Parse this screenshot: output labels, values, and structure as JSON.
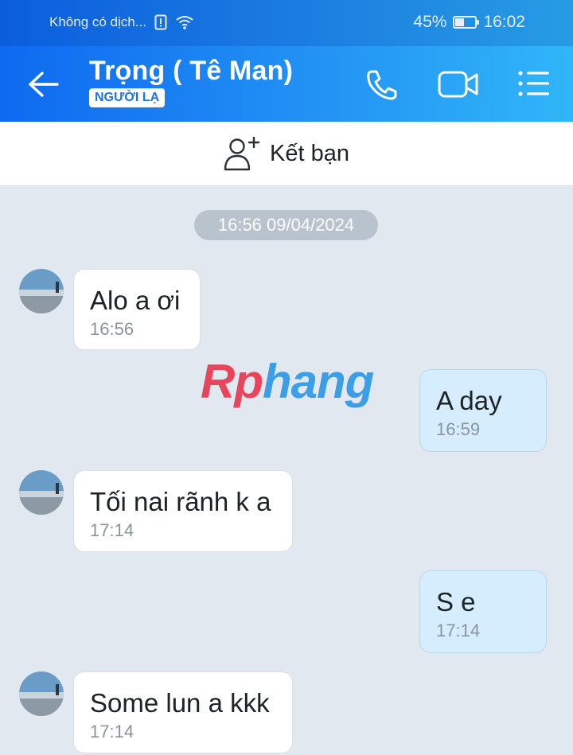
{
  "status_bar": {
    "carrier": "Không có dịch...",
    "battery_percent": "45%",
    "battery_level": 0.45,
    "time": "16:02"
  },
  "header": {
    "title": "Trọng ( Tê Man)",
    "badge": "NGƯỜI LẠ",
    "icons": [
      "back-arrow-icon",
      "phone-icon",
      "video-call-icon",
      "menu-icon"
    ],
    "gradient": [
      "#0e6af0",
      "#30b6f8"
    ]
  },
  "friend_bar": {
    "label": "Kết bạn",
    "icon": "add-friend-icon"
  },
  "date_divider": "16:56 09/04/2024",
  "watermark": {
    "part1": "Rp",
    "part2": "hang"
  },
  "messages": [
    {
      "side": "in",
      "text": "Alo a ơi",
      "time": "16:56"
    },
    {
      "side": "out",
      "text": "A day",
      "time": "16:59"
    },
    {
      "side": "in",
      "text": "Tối nai rãnh k a",
      "time": "17:14"
    },
    {
      "side": "out",
      "text": "S e",
      "time": "17:14"
    },
    {
      "side": "in",
      "text": "Some lun a kkk",
      "time": "17:14"
    }
  ],
  "colors": {
    "incoming_bubble": "#ffffff",
    "outgoing_bubble": "#d6edfd",
    "chat_background": "#e2e8ef"
  }
}
